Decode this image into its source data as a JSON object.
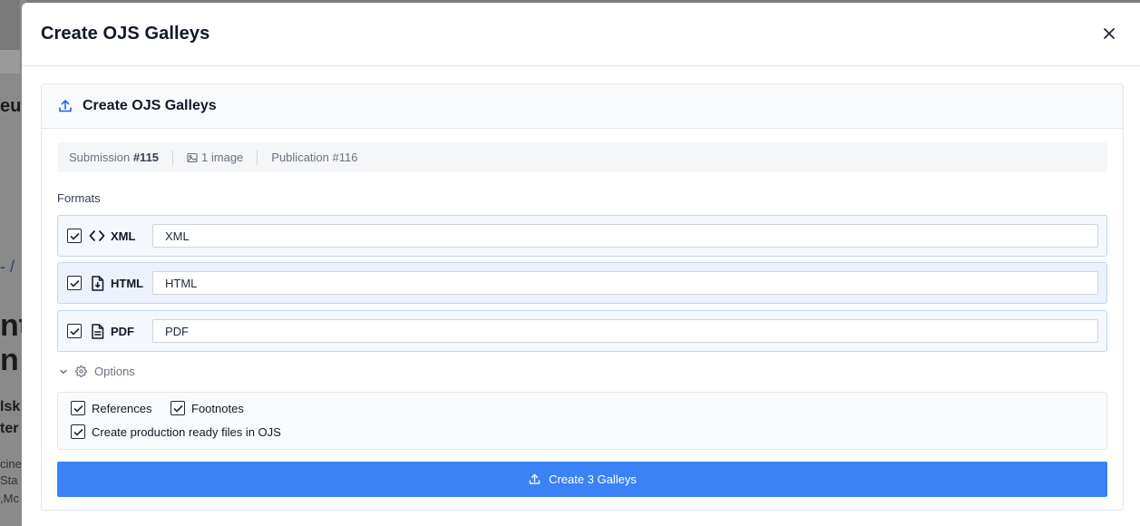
{
  "background": {
    "fragments": [
      "eu",
      "- /",
      "nt",
      "n",
      "lsk",
      "ter",
      "cine",
      "Sta",
      ",Mc"
    ]
  },
  "modal": {
    "title": "Create OJS Galleys",
    "close_icon": "close-icon"
  },
  "card": {
    "title": "Create OJS Galleys",
    "icon": "upload-icon"
  },
  "meta": {
    "submission_label": "Submission",
    "submission_id": "#115",
    "images": "1 image",
    "publication": "Publication #116"
  },
  "formats": {
    "label": "Formats",
    "items": [
      {
        "name": "XML",
        "value": "XML",
        "checked": true,
        "icon": "code-icon"
      },
      {
        "name": "HTML",
        "value": "HTML",
        "checked": true,
        "icon": "file-code-icon"
      },
      {
        "name": "PDF",
        "value": "PDF",
        "checked": true,
        "icon": "file-text-icon"
      }
    ]
  },
  "options": {
    "label": "Options",
    "items": [
      {
        "label": "References",
        "checked": true
      },
      {
        "label": "Footnotes",
        "checked": true
      },
      {
        "label": "Create production ready files in OJS",
        "checked": true
      }
    ]
  },
  "submit": {
    "label": "Create 3 Galleys"
  },
  "colors": {
    "primary": "#3b82f6",
    "row_border": "#bfd7f5",
    "row_bg": "#f4f8fd"
  }
}
